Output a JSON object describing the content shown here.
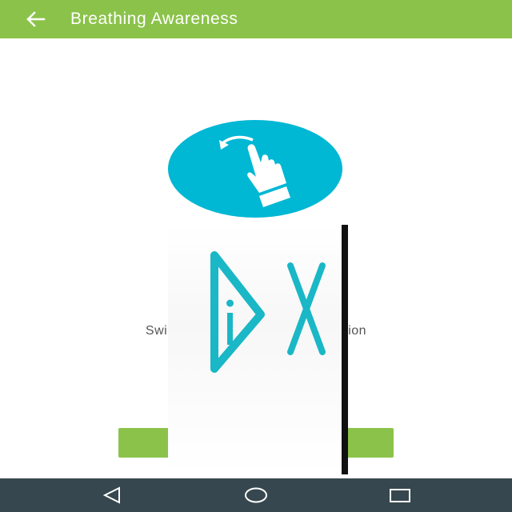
{
  "app_bar": {
    "title": "Breathing Awareness",
    "back_icon": "arrow-left-icon",
    "color": "#8bc34a"
  },
  "hint": {
    "icon": "swipe-left-hand-icon",
    "color": "#00b7d4"
  },
  "instruction": {
    "text_left": "Swi",
    "text_right": "ion"
  },
  "start_button": {
    "label": "",
    "color": "#8bc34a"
  },
  "ad": {
    "play_icon": "adchoices-play-icon",
    "close_icon": "close-x-icon",
    "color": "#1ab7c6"
  },
  "nav_bar": {
    "back_icon": "triangle-back-icon",
    "home_icon": "circle-home-icon",
    "recents_icon": "square-recents-icon",
    "color": "#37474f"
  }
}
